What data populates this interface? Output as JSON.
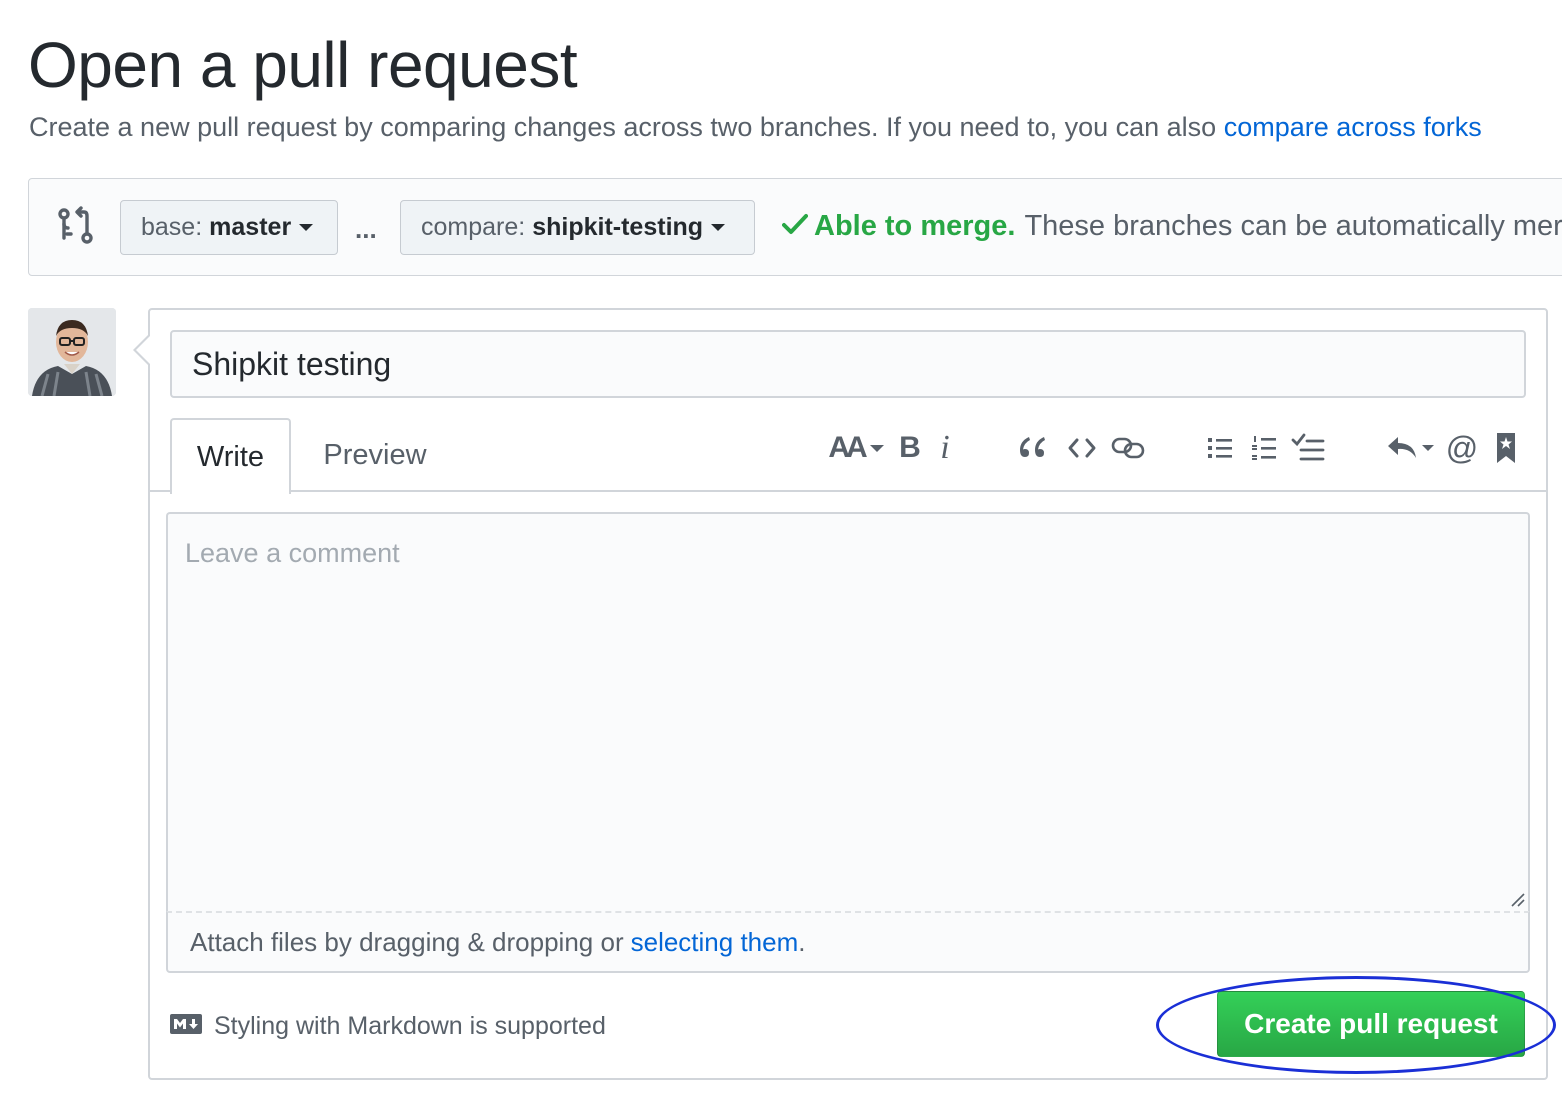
{
  "page": {
    "title": "Open a pull request",
    "subtitle_prefix": "Create a new pull request by comparing changes across two branches. If you need to, you can also",
    "subtitle_link": "compare across forks"
  },
  "range": {
    "base_label": "base:",
    "base_branch": "master",
    "separator": "...",
    "compare_label": "compare:",
    "compare_branch": "shipkit-testing",
    "merge_status": "Able to merge.",
    "merge_description": "These branches can be automatically merged."
  },
  "form": {
    "title_value": "Shipkit testing",
    "tabs": [
      {
        "label": "Write",
        "active": true
      },
      {
        "label": "Preview",
        "active": false
      }
    ],
    "toolbar": {
      "heading": "AA",
      "bold": "B",
      "italic": "i",
      "mention": "@"
    },
    "comment_placeholder": "Leave a comment",
    "attach_prefix": "Attach files by dragging & dropping or",
    "attach_link": "selecting them",
    "attach_suffix": ".",
    "markdown_note": "Styling with Markdown is supported",
    "submit_label": "Create pull request"
  },
  "colors": {
    "accent_blue": "#0366d6",
    "merge_green": "#28a745",
    "highlight_ellipse": "#1a2fd6"
  },
  "icons": [
    "git-compare-icon",
    "caret-down-icon",
    "check-icon",
    "avatar",
    "quote-icon",
    "code-icon",
    "link-icon",
    "unordered-list-icon",
    "ordered-list-icon",
    "task-list-icon",
    "reply-icon",
    "bookmark-icon",
    "markdown-icon"
  ]
}
